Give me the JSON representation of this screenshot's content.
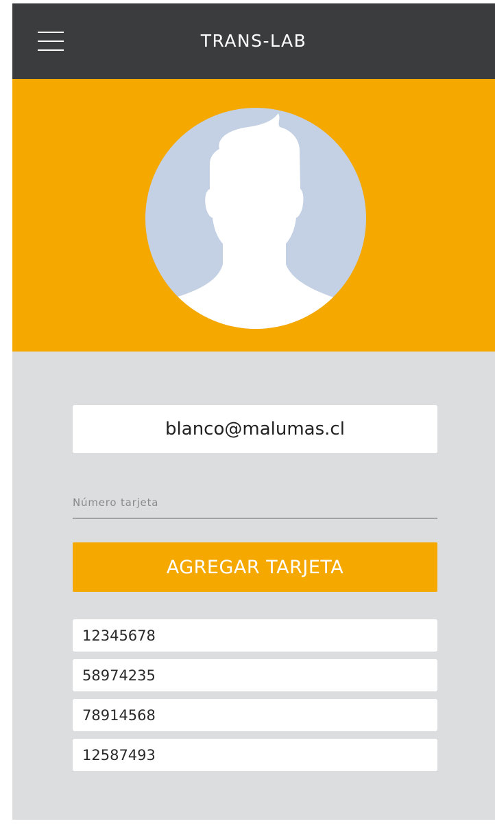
{
  "header": {
    "title": "TRANS-LAB",
    "menu_icon": "hamburger-menu-icon",
    "background_color": "#3b3c3e"
  },
  "profile": {
    "avatar_icon": "default-user-avatar-icon",
    "hero_color": "#f5a800",
    "email": "blanco@malumas.cl"
  },
  "form": {
    "card_number_placeholder": "Número tarjeta",
    "card_number_value": "",
    "add_button_label": "AGREGAR TARJETA",
    "accent_color": "#f5a800"
  },
  "cards": [
    {
      "number": "12345678"
    },
    {
      "number": "58974235"
    },
    {
      "number": "78914568"
    },
    {
      "number": "12587493"
    }
  ]
}
